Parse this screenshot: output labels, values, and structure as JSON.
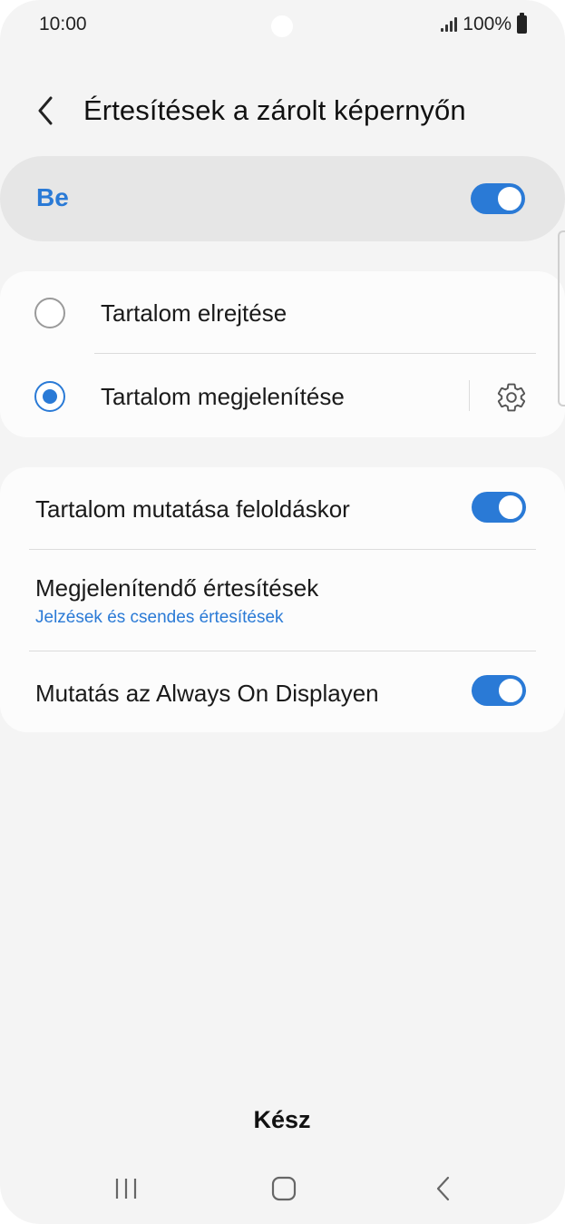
{
  "status_bar": {
    "time": "10:00",
    "battery": "100%"
  },
  "header": {
    "title": "Értesítések a zárolt képernyőn",
    "back_icon": "chevron-left-icon"
  },
  "master": {
    "label": "Be",
    "enabled": true
  },
  "content_options": {
    "items": [
      {
        "label": "Tartalom elrejtése",
        "selected": false
      },
      {
        "label": "Tartalom megjelenítése",
        "selected": true
      }
    ],
    "settings_icon": "gear-icon"
  },
  "settings": {
    "show_on_unlock": {
      "label": "Tartalom mutatása feloldáskor",
      "enabled": true
    },
    "notifications_to_show": {
      "label": "Megjelenítendő értesítések",
      "value": "Jelzések és csendes értesítések"
    },
    "always_on_display": {
      "label": "Mutatás az Always On Displayen",
      "enabled": true
    }
  },
  "done_label": "Kész",
  "nav_bar": {
    "recents_icon": "recents-icon",
    "home_icon": "home-icon",
    "back_icon": "back-icon"
  },
  "colors": {
    "accent": "#2a7ad6",
    "background": "#f4f4f4",
    "card": "#fcfcfc",
    "master_card": "#e6e6e6"
  }
}
